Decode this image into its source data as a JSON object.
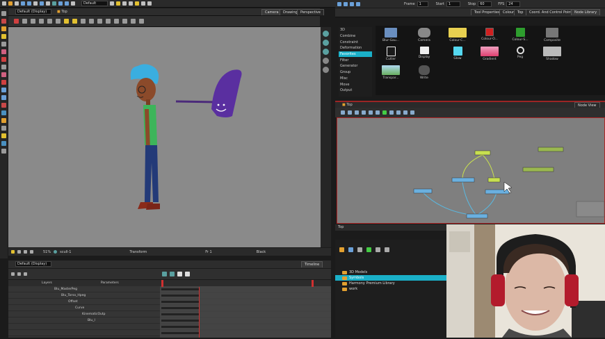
{
  "toolbar": {
    "workspace_field": "Default",
    "frame_label": "Frame",
    "frame_value": "1",
    "start_label": "Start",
    "start_value": "1",
    "stop_label": "Stop",
    "stop_value": "60",
    "fps_label": "FPS",
    "fps_value": "24"
  },
  "camera_view": {
    "display_selector": "Default (Display)",
    "breadcrumb": "Top",
    "tabs": [
      "Camera",
      "Drawing",
      "Perspective"
    ],
    "status_zoom": "51%",
    "status_drawing": "scull-1",
    "status_mode": "Transform",
    "status_frame": "Fr 1",
    "status_color": "Black"
  },
  "timeline": {
    "display_selector": "Default (Display)",
    "tab": "Timeline",
    "col_layers": "Layers",
    "col_parameters": "Parameters",
    "layers": [
      "Blu_MasterPeg",
      "Blu_Torso_Hpeg",
      "Offset",
      "Curve",
      "KinematicOutp",
      "Blu_l"
    ]
  },
  "library_panel": {
    "tabs": [
      "Tool Properties",
      "Colour",
      "Top",
      "Coord. And Control Points",
      "Node Library"
    ],
    "categories": [
      "3D",
      "Combine",
      "Constraint",
      "Deformation",
      "Favorites",
      "Filter",
      "Generator",
      "Group",
      "Misc",
      "Move",
      "Output"
    ],
    "selected_category": "Favorites",
    "nodes": [
      "Blur-Gau...",
      "Camera",
      "Colour-C...",
      "Colour-O...",
      "Colour-S...",
      "Composite",
      "Cutter",
      "Display",
      "Glow",
      "Gradient",
      "Peg",
      "Shadow",
      "Transpar...",
      "Write"
    ]
  },
  "node_view": {
    "breadcrumb": "Top",
    "tab": "Node View",
    "footer_breadcrumb": "Top"
  },
  "library": {
    "items": [
      "3D Models",
      "Symbols",
      "Harmony Premium Library",
      "work"
    ],
    "selected": "Symbols"
  },
  "colors": {
    "accent": "#1ab0c8",
    "node_view_border": "#b02424",
    "stage_bg": "#8a8a8a"
  }
}
